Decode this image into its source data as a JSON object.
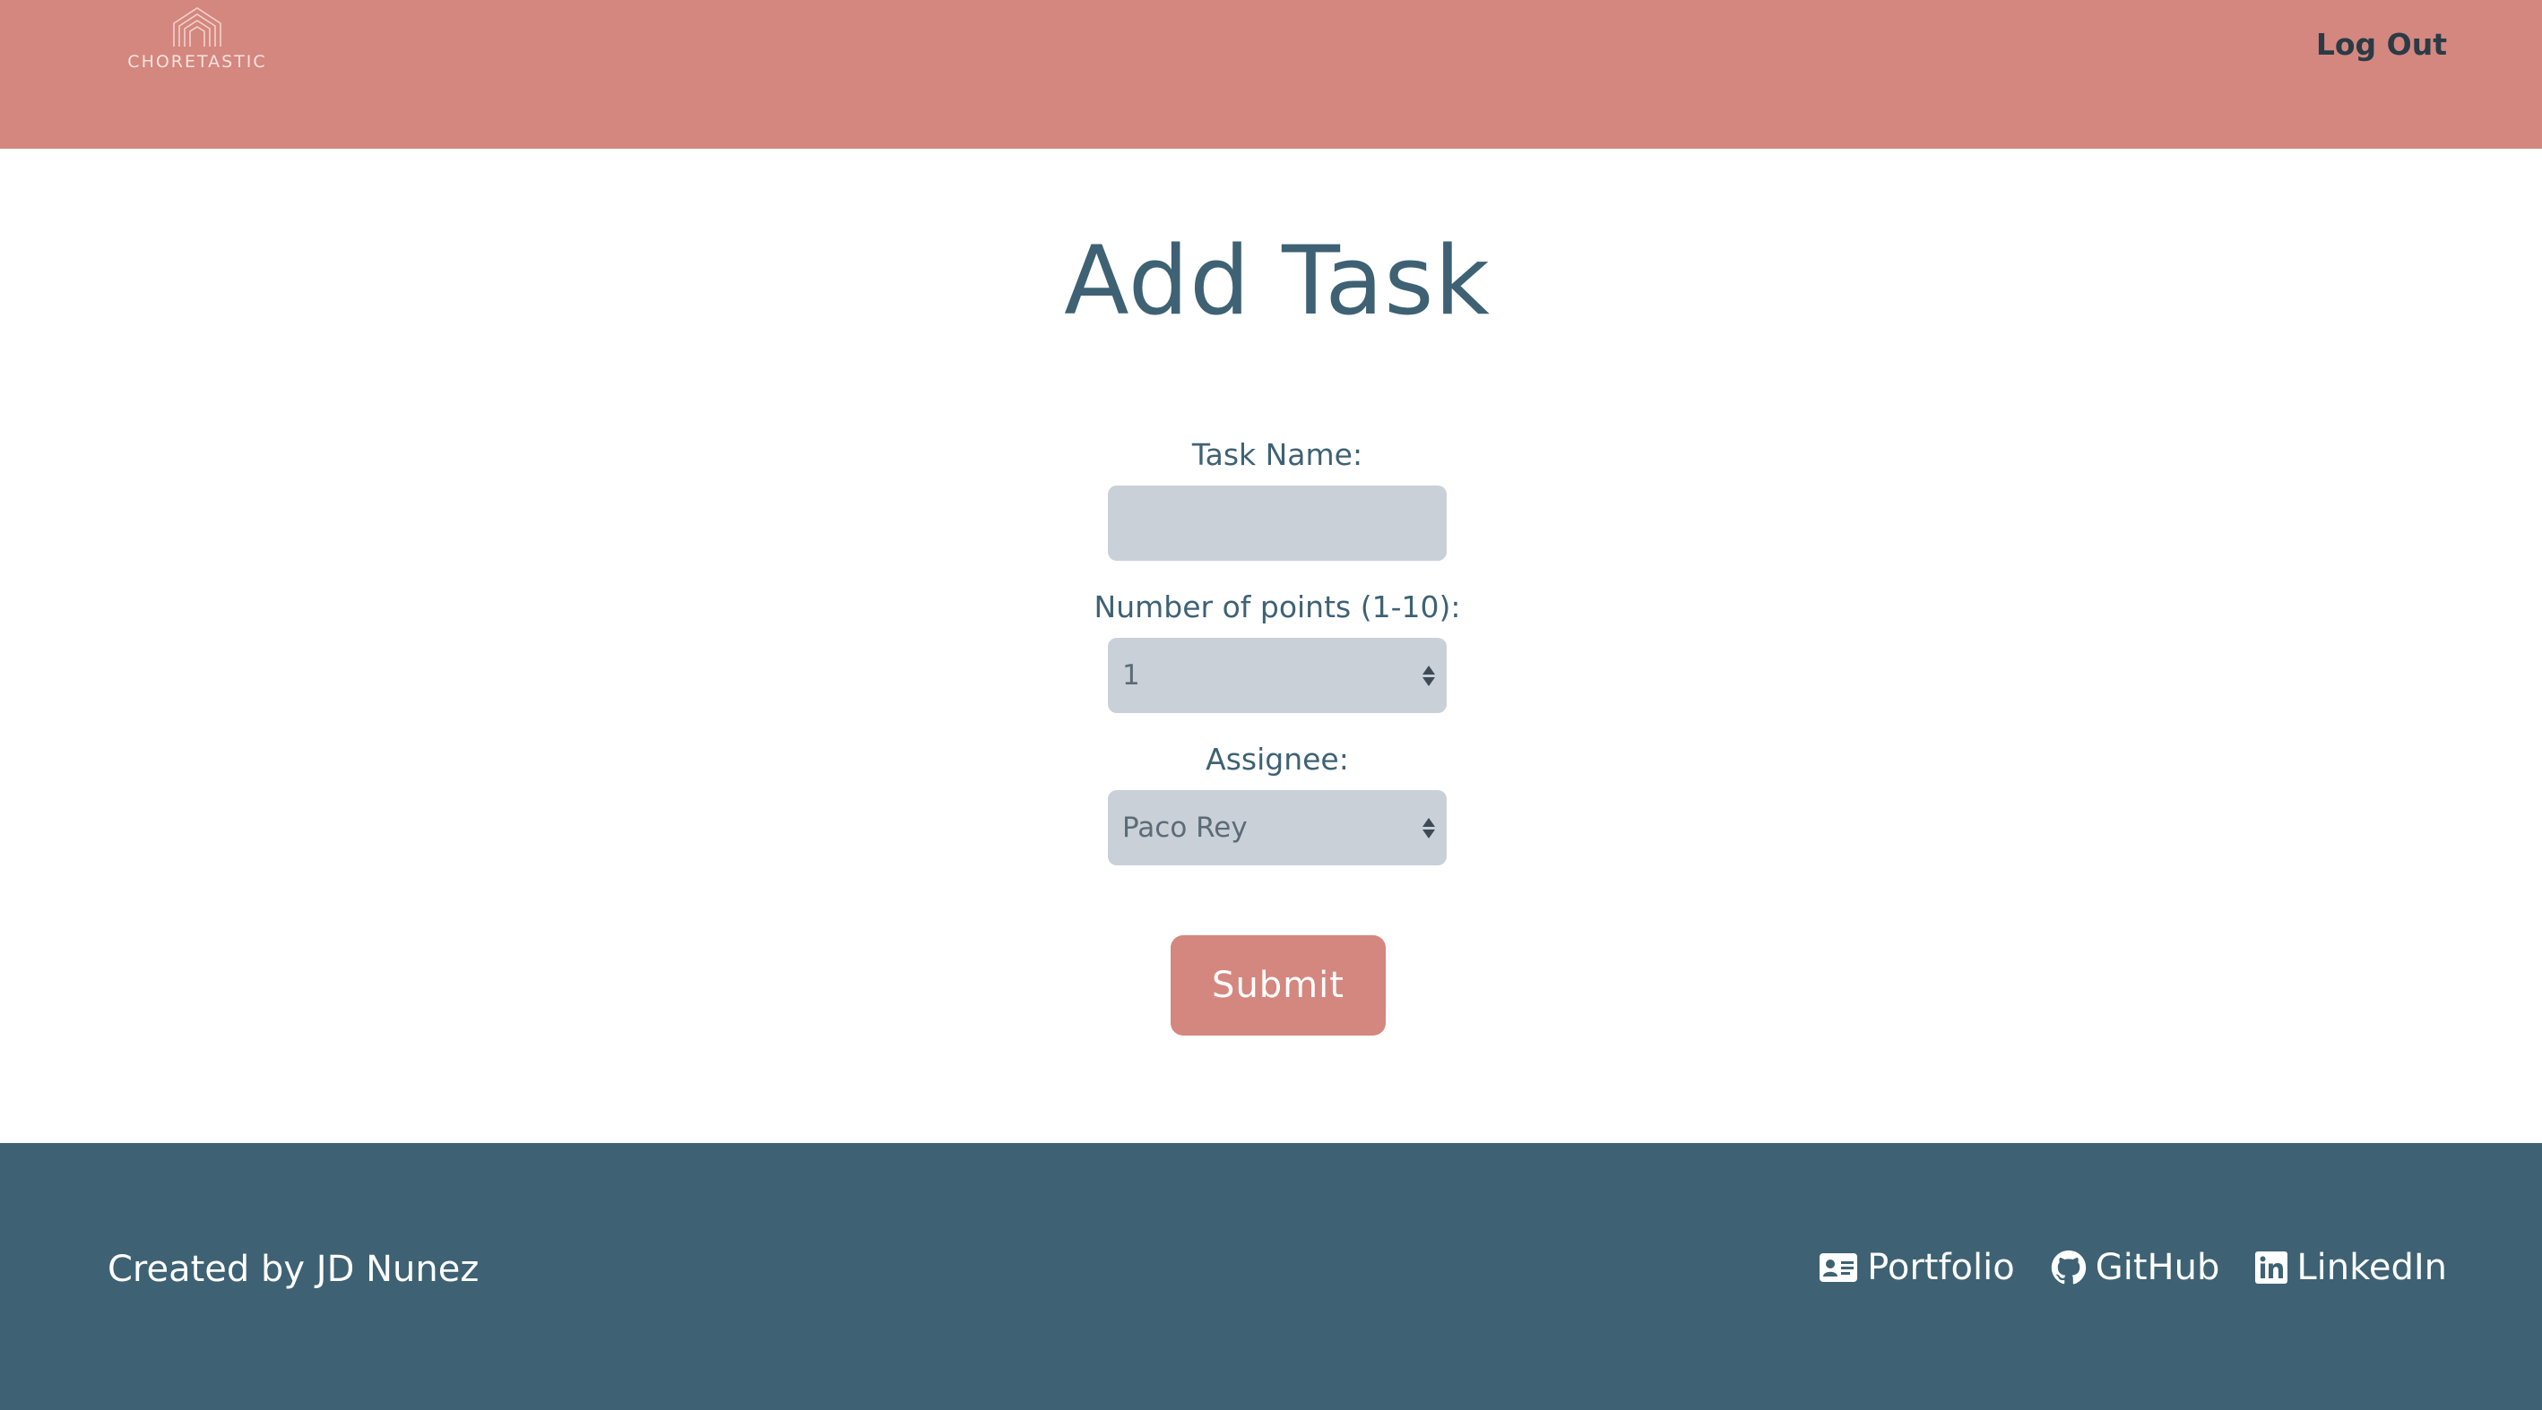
{
  "header": {
    "logo_text": "CHORETASTIC",
    "logout_label": "Log Out",
    "background_color": "#d4877f"
  },
  "main": {
    "title": "Add Task",
    "form": {
      "task_name_label": "Task Name:",
      "task_name_value": "",
      "points_label": "Number of points (1-10):",
      "points_value": "1",
      "assignee_label": "Assignee:",
      "assignee_value": "Paco Rey",
      "submit_label": "Submit"
    }
  },
  "footer": {
    "credit": "Created by JD Nunez",
    "background_color": "#3e6274",
    "links": [
      {
        "label": "Portfolio",
        "icon": "id-card-icon"
      },
      {
        "label": "GitHub",
        "icon": "github-icon"
      },
      {
        "label": "LinkedIn",
        "icon": "linkedin-icon"
      }
    ]
  }
}
